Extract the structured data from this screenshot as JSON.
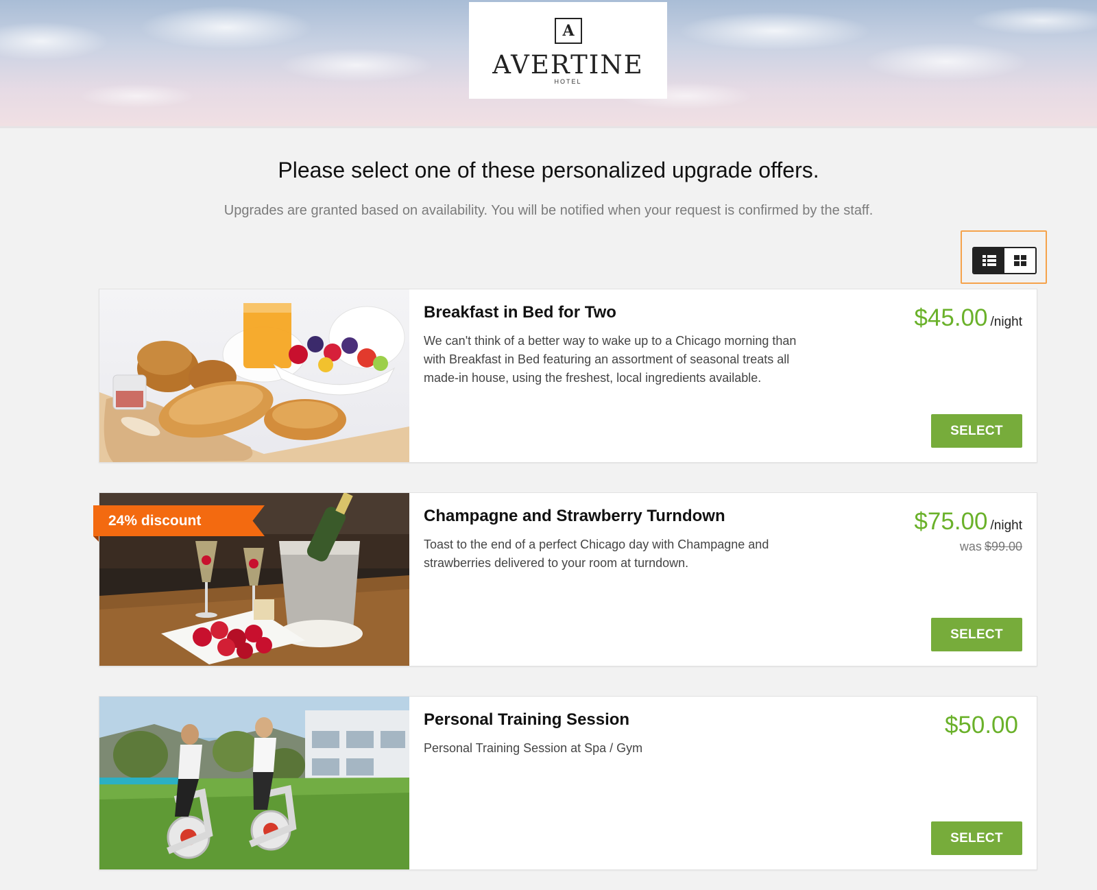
{
  "brand": {
    "mark": "A",
    "name": "AVERTINE",
    "sub": "HOTEL"
  },
  "intro": {
    "headline": "Please select one of these personalized upgrade offers.",
    "subline": "Upgrades are granted based on availability. You will be notified when your request is confirmed by the staff."
  },
  "view_toggle": {
    "options": [
      "list-view",
      "grid-view"
    ],
    "selected": "list-view"
  },
  "colors": {
    "price_green": "#6ab12a",
    "button_green": "#77ac3b",
    "ribbon_orange": "#f36a10",
    "toggle_highlight": "#f5a24a"
  },
  "offers": [
    {
      "title": "Breakfast in Bed for Two",
      "description": "We can't think of a better way to wake up to a Chicago morning than with Breakfast in Bed featuring an assortment of seasonal treats all made-in house, using the freshest, local ingredients available.",
      "price": "$45.00",
      "unit": "/night",
      "select_label": "SELECT"
    },
    {
      "title": "Champagne and Strawberry Turndown",
      "description": "Toast to the end of a perfect Chicago day with Champagne and strawberries delivered to your room at turndown.",
      "price": "$75.00",
      "unit": "/night",
      "was_label": "was",
      "was_price": "$99.00",
      "badge": "24% discount",
      "select_label": "SELECT"
    },
    {
      "title": "Personal Training Session",
      "description": "Personal Training Session at Spa / Gym",
      "price": "$50.00",
      "select_label": "SELECT"
    }
  ]
}
